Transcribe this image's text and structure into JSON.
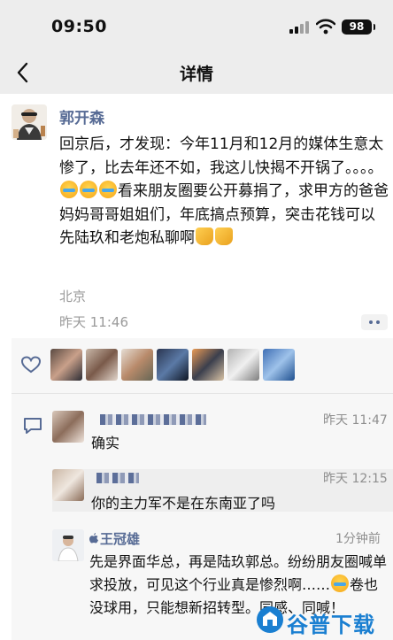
{
  "status_bar": {
    "time": "09:50",
    "battery": "98"
  },
  "nav": {
    "title": "详情"
  },
  "post": {
    "author": "郭开森",
    "text_parts": {
      "p1": "回京后，才发现：今年11月和12月的媒体生意太惨了，比去年还不如，我这儿快揭不开锅了。。。。",
      "p2": "看来朋友圈要公开募捐了，求甲方的爸爸妈妈哥哥姐姐们，年底搞点预算，突击花钱可以先陆玖和老炮私聊啊"
    },
    "location": "北京",
    "time": "昨天 11:46"
  },
  "comments": [
    {
      "name": "",
      "time": "昨天 11:47",
      "text": "确实"
    },
    {
      "name": "",
      "time": "昨天 12:15",
      "text": "你的主力军不是在东南亚了吗"
    },
    {
      "name": "王冠雄",
      "time": "1分钟前",
      "text_a": "先是界面华总，再是陆玖郭总。纷纷朋友圈喊单求投放，可见这个行业真是惨烈啊……",
      "text_b": "卷也没球用，只能想新招转型。同感、同喊！"
    }
  ],
  "watermark": "谷普下载",
  "colors": {
    "name_blue": "#576b95",
    "background": "#ededed",
    "comment_bg": "#f7f7f7",
    "meta_gray": "#9a9a9a"
  },
  "icons": [
    "back-arrow-icon",
    "signal-icon",
    "wifi-icon",
    "battery-icon",
    "more-icon",
    "like-heart-icon",
    "comment-icon",
    "crying-emoji-icon",
    "folded-hands-emoji-icon",
    "apple-icon"
  ]
}
